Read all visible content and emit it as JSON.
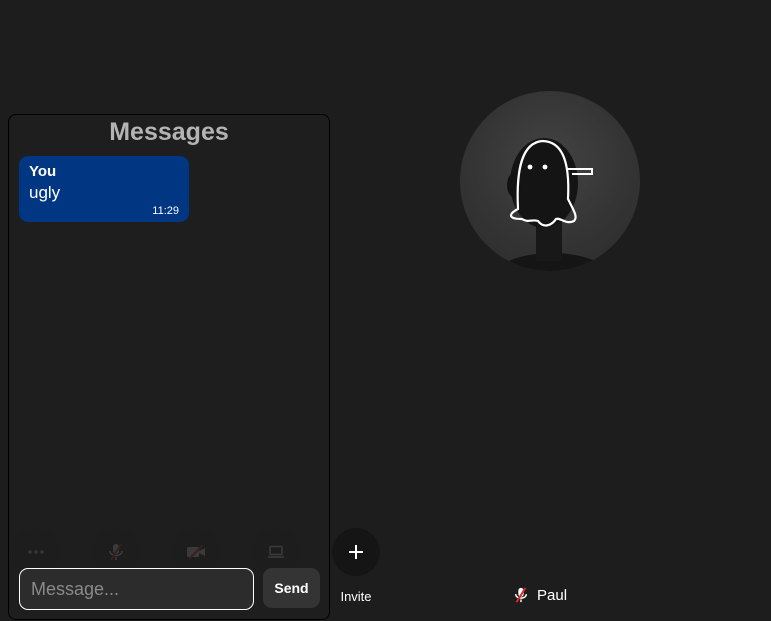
{
  "chat": {
    "title": "Messages",
    "messages": [
      {
        "author": "You",
        "text": "ugly",
        "time": "11:29"
      }
    ],
    "input_placeholder": "Message...",
    "send_label": "Send"
  },
  "controls": {
    "invite_label": "Invite",
    "icons": [
      "more-icon",
      "mic-muted-icon",
      "camera-off-icon",
      "screen-share-icon",
      "plus-icon"
    ]
  },
  "participant": {
    "name": "Paul",
    "mic_status": "muted"
  },
  "colors": {
    "background": "#1d1d1d",
    "bubble": "#003682",
    "muted_red": "#e0242a"
  }
}
